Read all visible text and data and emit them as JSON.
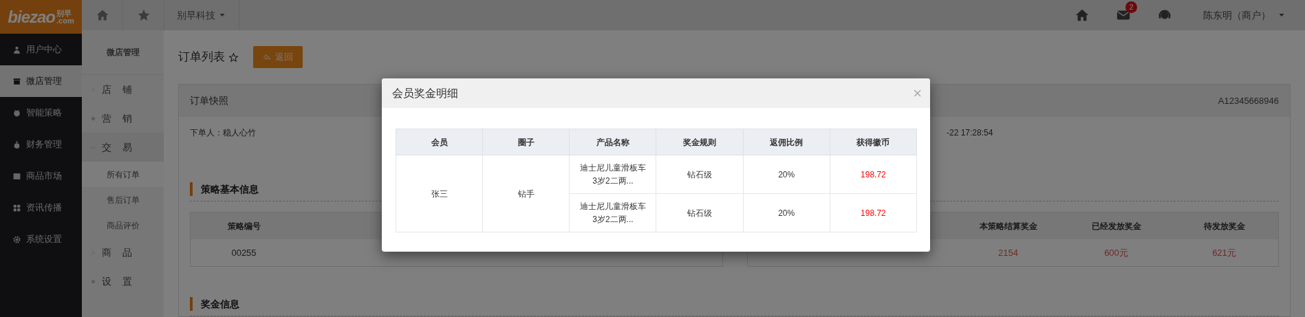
{
  "logo": {
    "text": "biezao",
    "cn": "别早",
    "domain": ".com"
  },
  "topbar": {
    "company": "别早科技",
    "mail_badge": "2",
    "user": "陈东明（商户）"
  },
  "nav": [
    {
      "label": "用户中心",
      "selected": false
    },
    {
      "label": "微店管理",
      "selected": true
    },
    {
      "label": "智能策略",
      "selected": false
    },
    {
      "label": "财务管理",
      "selected": false
    },
    {
      "label": "商品市场",
      "selected": false
    },
    {
      "label": "资讯传播",
      "selected": false
    },
    {
      "label": "系统设置",
      "selected": false
    }
  ],
  "subnav": {
    "title": "微店管理",
    "items": [
      {
        "label": "店 铺",
        "kind": "group",
        "expanded": false
      },
      {
        "label": "营 销",
        "kind": "link"
      },
      {
        "label": "交 易",
        "kind": "group",
        "expanded": true,
        "children": [
          {
            "label": "所有订单",
            "selected": true
          },
          {
            "label": "售后订单",
            "selected": false
          },
          {
            "label": "商品评价",
            "selected": false
          }
        ]
      },
      {
        "label": "商 品",
        "kind": "group",
        "expanded": false
      },
      {
        "label": "设 置",
        "kind": "link"
      }
    ]
  },
  "page": {
    "title": "订单列表",
    "back_button": "返回"
  },
  "snapshot": {
    "title": "订单快照",
    "order_no": "A12345668946",
    "buyer": "下单人：稳人心竹",
    "time": "-22 17:28:54"
  },
  "strategy": {
    "title": "策略基本信息",
    "left_table": {
      "columns": [
        "策略编号"
      ],
      "rows": [
        [
          "00255"
        ]
      ]
    },
    "right_table": {
      "columns": [
        "本策略结算奖金",
        "已经发放奖金",
        "待发放奖金"
      ],
      "rows": [
        [
          "2154",
          "600元",
          "621元"
        ]
      ]
    }
  },
  "bonus": {
    "title": "奖金信息"
  },
  "modal": {
    "title": "会员奖金明细",
    "close": "×",
    "columns": [
      "会员",
      "圈子",
      "产品名称",
      "奖金规则",
      "返佣比例",
      "获得徽币"
    ],
    "member": "张三",
    "circle": "钻手",
    "rows": [
      {
        "product": "迪士尼儿童滑板车3岁2二两...",
        "rule": "钻石级",
        "ratio": "20%",
        "coins": "198.72"
      },
      {
        "product": "迪士尼儿童滑板车3岁2二两...",
        "rule": "钻石级",
        "ratio": "20%",
        "coins": "198.72"
      }
    ]
  }
}
